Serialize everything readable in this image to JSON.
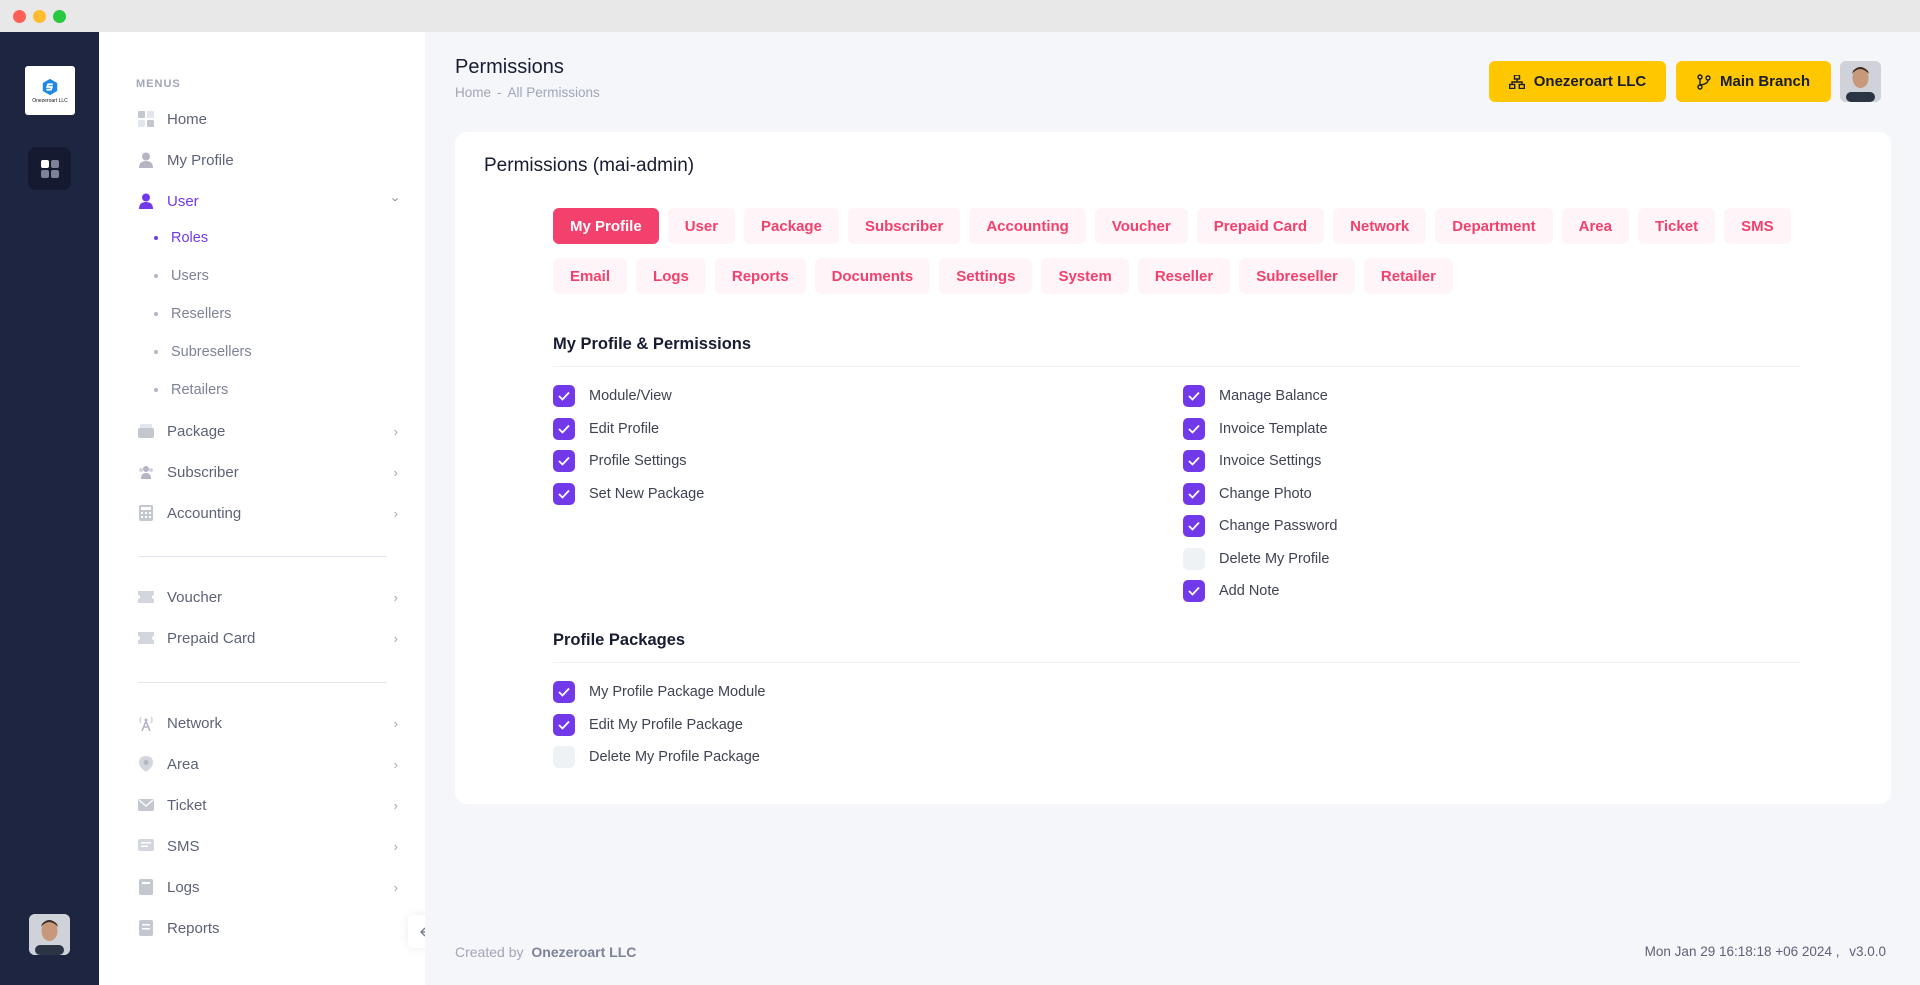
{
  "app": {
    "logo_text": "Onezeroart LLC"
  },
  "sidebar": {
    "menus_title": "MENUS",
    "items": [
      {
        "label": "Home",
        "icon": "home-grid-icon"
      },
      {
        "label": "My Profile",
        "icon": "user-icon"
      },
      {
        "label": "User",
        "icon": "user-icon",
        "expanded": true
      },
      {
        "label": "Package",
        "icon": "package-icon"
      },
      {
        "label": "Subscriber",
        "icon": "users-icon"
      },
      {
        "label": "Accounting",
        "icon": "calculator-icon"
      },
      {
        "label": "Voucher",
        "icon": "ticket-icon"
      },
      {
        "label": "Prepaid Card",
        "icon": "card-icon"
      },
      {
        "label": "Network",
        "icon": "antenna-icon"
      },
      {
        "label": "Area",
        "icon": "location-icon"
      },
      {
        "label": "Ticket",
        "icon": "envelope-icon"
      },
      {
        "label": "SMS",
        "icon": "message-icon"
      },
      {
        "label": "Logs",
        "icon": "book-icon"
      },
      {
        "label": "Reports",
        "icon": "report-icon"
      }
    ],
    "user_submenu": [
      "Roles",
      "Users",
      "Resellers",
      "Subresellers",
      "Retailers"
    ]
  },
  "header": {
    "title": "Permissions",
    "breadcrumb": [
      "Home",
      "-",
      "All Permissions"
    ],
    "org_button": "Onezeroart LLC",
    "branch_button": "Main Branch"
  },
  "card": {
    "title": "Permissions (mai-admin)",
    "tabs": [
      "My Profile",
      "User",
      "Package",
      "Subscriber",
      "Accounting",
      "Voucher",
      "Prepaid Card",
      "Network",
      "Department",
      "Area",
      "Ticket",
      "SMS",
      "Email",
      "Logs",
      "Reports",
      "Documents",
      "Settings",
      "System",
      "Reseller",
      "Subreseller",
      "Retailer"
    ],
    "active_tab": "My Profile",
    "section1": {
      "title": "My Profile & Permissions",
      "left": [
        {
          "label": "Module/View",
          "checked": true
        },
        {
          "label": "Edit Profile",
          "checked": true
        },
        {
          "label": "Profile Settings",
          "checked": true
        },
        {
          "label": "Set New Package",
          "checked": true
        }
      ],
      "right": [
        {
          "label": "Manage Balance",
          "checked": true
        },
        {
          "label": "Invoice Template",
          "checked": true
        },
        {
          "label": "Invoice Settings",
          "checked": true
        },
        {
          "label": "Change Photo",
          "checked": true
        },
        {
          "label": "Change Password",
          "checked": true
        },
        {
          "label": "Delete My Profile",
          "checked": false
        },
        {
          "label": "Add Note",
          "checked": true
        }
      ]
    },
    "section2": {
      "title": "Profile Packages",
      "items": [
        {
          "label": "My Profile Package Module",
          "checked": true
        },
        {
          "label": "Edit My Profile Package",
          "checked": true
        },
        {
          "label": "Delete My Profile Package",
          "checked": false
        }
      ]
    }
  },
  "footer": {
    "created_by": "Created by",
    "brand": "Onezeroart LLC",
    "datetime": "Mon Jan 29 16:18:18 +06 2024 ,",
    "version": "v3.0.0"
  },
  "colors": {
    "sidebar_dark": "#1e2540",
    "accent_purple": "#7239ea",
    "tab_red": "#f1416c",
    "header_button_yellow": "#ffc700"
  }
}
